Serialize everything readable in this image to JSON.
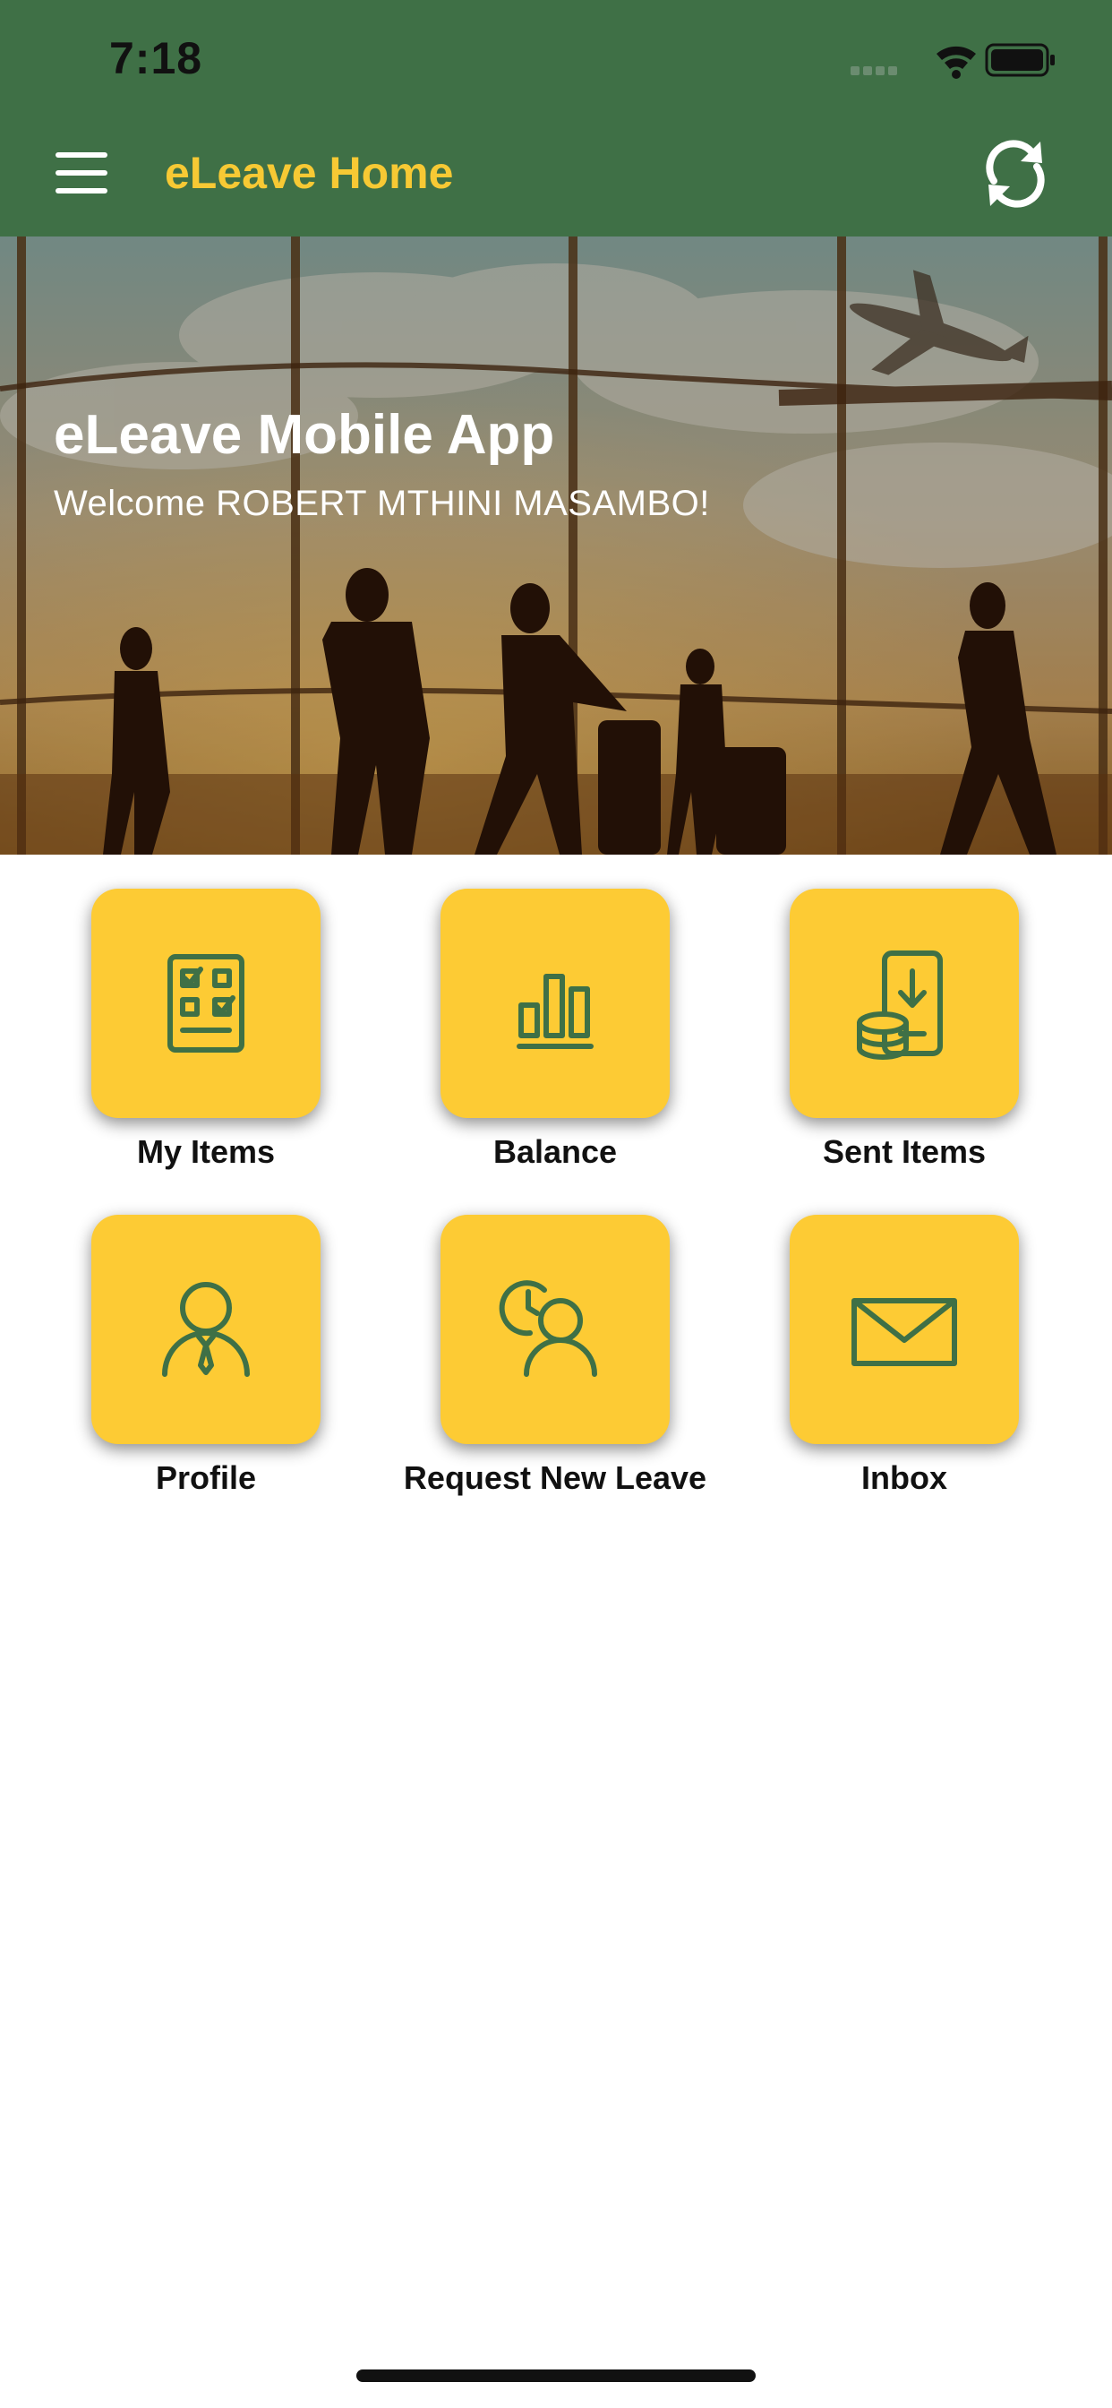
{
  "status_bar": {
    "time": "7:18",
    "icons": [
      "signal-icon",
      "wifi-icon",
      "battery-icon"
    ]
  },
  "app_bar": {
    "title": "eLeave Home",
    "menu_icon": "hamburger-menu-icon",
    "refresh_icon": "refresh-icon"
  },
  "hero": {
    "title": "eLeave Mobile App",
    "subtitle": "Welcome ROBERT MTHINI MASAMBO!"
  },
  "tiles": [
    {
      "label": "My Items",
      "icon": "checklist-icon"
    },
    {
      "label": "Balance",
      "icon": "bar-chart-icon"
    },
    {
      "label": "Sent Items",
      "icon": "phone-download-coins-icon"
    },
    {
      "label": "Profile",
      "icon": "user-tie-icon"
    },
    {
      "label": "Request New Leave",
      "icon": "user-clock-icon"
    },
    {
      "label": "Inbox",
      "icon": "envelope-icon"
    }
  ],
  "colors": {
    "app_bar": "#3f7046",
    "title_accent": "#f7c934",
    "tile": "#fdcb34",
    "icon_stroke": "#3f7046"
  }
}
